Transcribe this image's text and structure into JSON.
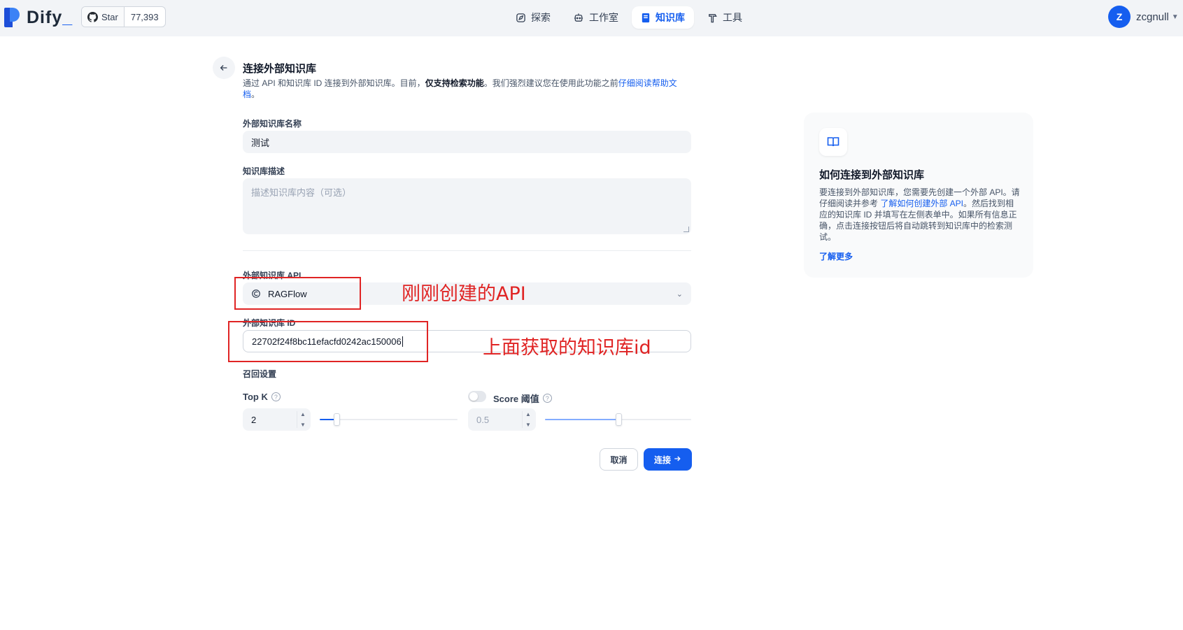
{
  "app": {
    "logo_text": "Dify",
    "logo_suffix": "_",
    "github": {
      "star_label": "Star",
      "star_count": "77,393"
    }
  },
  "nav": {
    "items": [
      {
        "label": "探索",
        "icon": "compass-icon"
      },
      {
        "label": "工作室",
        "icon": "robot-icon"
      },
      {
        "label": "知识库",
        "icon": "book-icon",
        "active": true
      },
      {
        "label": "工具",
        "icon": "hammer-icon"
      }
    ]
  },
  "user": {
    "avatar_letter": "Z",
    "name": "zcgnull"
  },
  "form": {
    "title": "连接外部知识库",
    "desc_pre": "通过 API 和知识库 ID 连接到外部知识库。目前，",
    "desc_bold": "仅支持检索功能",
    "desc_mid": "。我们强烈建议您在使用此功能之前",
    "desc_link": "仔细阅读帮助文档",
    "desc_end": "。",
    "name_label": "外部知识库名称",
    "name_value": "测试",
    "desc_label": "知识库描述",
    "desc_placeholder": "描述知识库内容（可选）",
    "api_label": "外部知识库 API",
    "api_value": "RAGFlow",
    "id_label": "外部知识库 ID",
    "id_value": "22702f24f8bc11efacfd0242ac150006",
    "retrieval_label": "召回设置",
    "topk_label": "Top K",
    "topk_value": "2",
    "topk_slider_fraction": 0.12,
    "score_label": "Score 阈值",
    "score_value": "0.5",
    "score_slider_fraction": 0.5,
    "score_enabled": false,
    "cancel_label": "取消",
    "connect_label": "连接"
  },
  "annotations": {
    "api_note": "刚刚创建的API",
    "id_note": "上面获取的知识库id",
    "color": "#e02424"
  },
  "help": {
    "title": "如何连接到外部知识库",
    "body_pre": "要连接到外部知识库，您需要先创建一个外部 API。请仔细阅读并参考 ",
    "body_link": "了解如何创建外部 API",
    "body_post": "。然后找到相应的知识库 ID 并填写在左侧表单中。如果所有信息正确，点击连接按钮后将自动跳转到知识库中的检索测试。",
    "more_label": "了解更多"
  },
  "colors": {
    "accent": "#155eef",
    "nav_bg": "#f2f4f7"
  }
}
